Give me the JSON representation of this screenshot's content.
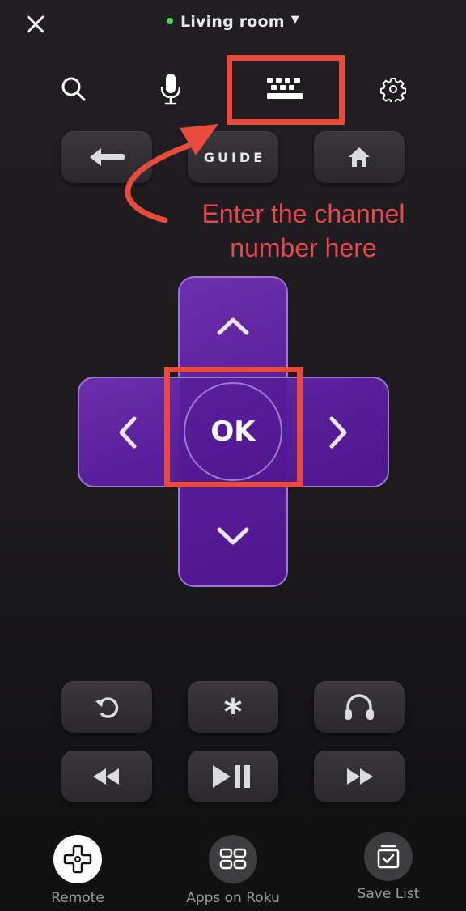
{
  "header": {
    "close_icon": "close-icon",
    "device_name": "Living room",
    "status_color": "#4cd35a",
    "dropdown_caret": "▼"
  },
  "toolbar": {
    "icons": [
      "search-icon",
      "microphone-icon",
      "keyboard-icon",
      "gear-icon"
    ]
  },
  "buttons_top": {
    "back": "back-arrow-icon",
    "guide_label": "GUIDE",
    "home": "home-icon"
  },
  "annotation": {
    "line1": "Enter the channel",
    "line2": "number here",
    "color": "#e84a3c"
  },
  "dpad": {
    "ok_label": "OK",
    "up": "chevron-up-icon",
    "down": "chevron-down-icon",
    "left": "chevron-left-icon",
    "right": "chevron-right-icon",
    "color": "#5a1f9c"
  },
  "buttons_bottom": {
    "replay": "replay-icon",
    "options": "*",
    "headphones": "headphones-icon",
    "rewind": "rewind-icon",
    "play_pause": "play-pause-icon",
    "fast_forward": "fast-forward-icon"
  },
  "bottom_nav": {
    "items": [
      {
        "label": "Remote",
        "icon": "remote-dpad-icon",
        "active": true
      },
      {
        "label": "Apps on Roku",
        "icon": "apps-grid-icon",
        "active": false
      },
      {
        "label": "Save List",
        "icon": "save-list-icon",
        "active": false
      }
    ]
  }
}
